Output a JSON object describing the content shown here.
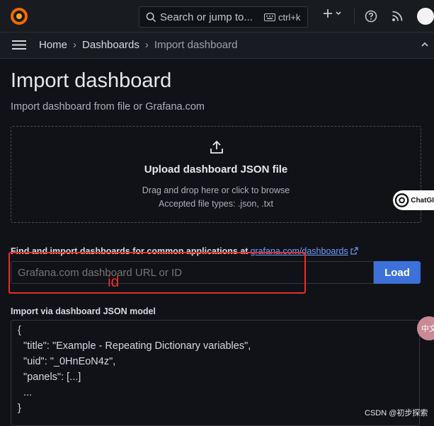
{
  "topbar": {
    "search_placeholder": "Search or jump to...",
    "search_shortcut": "ctrl+k",
    "add_icon": "plus-icon",
    "help_icon": "help-circle-icon",
    "news_icon": "rss-icon"
  },
  "breadcrumb": {
    "items": [
      "Home",
      "Dashboards",
      "Import dashboard"
    ]
  },
  "page": {
    "title": "Import dashboard",
    "subtitle": "Import dashboard from file or Grafana.com"
  },
  "upload": {
    "title": "Upload dashboard JSON file",
    "hint": "Drag and drop here or click to browse",
    "types": "Accepted file types: .json, .txt"
  },
  "grafana_com": {
    "label": "Find and import dashboards for common applications at",
    "link": "grafana.com/dashboards",
    "placeholder": "Grafana.com dashboard URL or ID",
    "load_label": "Load",
    "annotation": "id"
  },
  "json_model": {
    "label": "Import via dashboard JSON model",
    "lines": [
      "{",
      "  \"title\": \"Example - Repeating Dictionary variables\",",
      "  \"uid\": \"_0HnEoN4z\",",
      "  \"panels\": [...]",
      "  ...",
      "}"
    ]
  },
  "overlay": {
    "chatgpt_badge": "ChatGI",
    "side_badge": "中文",
    "watermark": "CSDN @初步探索"
  },
  "colors": {
    "background": "#111217",
    "accent": "#3d71d9",
    "annotation_red": "#e0322c"
  }
}
